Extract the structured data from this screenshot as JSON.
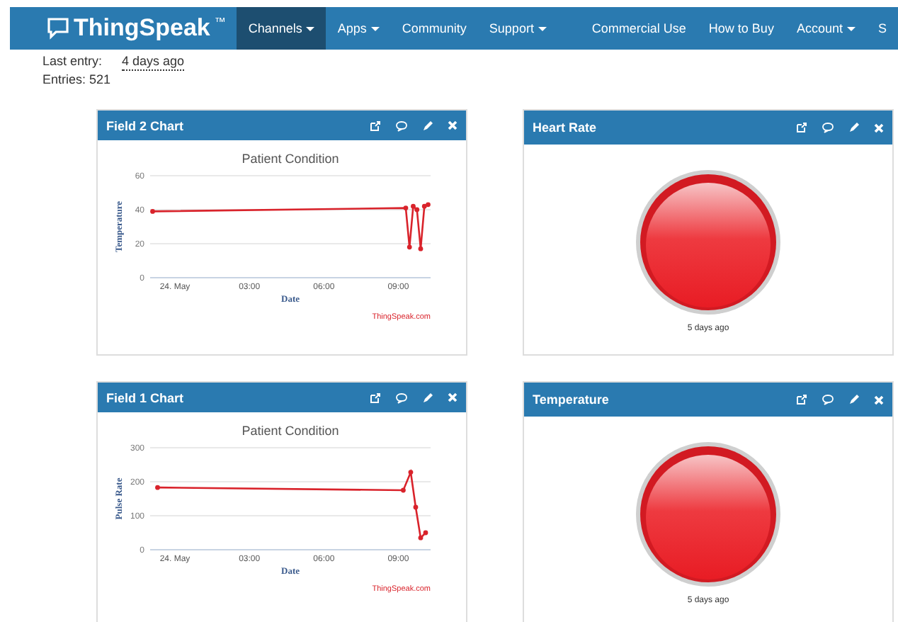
{
  "navbar": {
    "logo": "ThingSpeak",
    "trademark": "™",
    "items": [
      {
        "label": "Channels",
        "dropdown": true,
        "selected": true
      },
      {
        "label": "Apps",
        "dropdown": true,
        "selected": false
      },
      {
        "label": "Community",
        "dropdown": false,
        "selected": false
      },
      {
        "label": "Support",
        "dropdown": true,
        "selected": false
      }
    ],
    "right_items": [
      {
        "label": "Commercial Use",
        "dropdown": false,
        "selected": false
      },
      {
        "label": "How to Buy",
        "dropdown": false,
        "selected": false
      },
      {
        "label": "Account",
        "dropdown": true,
        "selected": false
      },
      {
        "label": "S",
        "dropdown": false,
        "selected": false
      }
    ]
  },
  "channel_info": {
    "last_entry_label": "Last entry:",
    "last_entry_value": "4 days ago",
    "entries": "Entries: 521"
  },
  "widgets": [
    {
      "kind": "chart",
      "title": "Field 2 Chart",
      "credit": "ThingSpeak.com",
      "chart_data": {
        "type": "line",
        "title": "Patient Condition",
        "xlabel": "Date",
        "ylabel": "Temperature",
        "x": [
          -0.9,
          9.3,
          9.45,
          9.6,
          9.75,
          9.9,
          10.05,
          10.2
        ],
        "series": [
          {
            "color": "#d9232b",
            "marker": "circle",
            "values": [
              39,
              41,
              18,
              42,
              40,
              17,
              42,
              43
            ]
          }
        ],
        "xlim": [
          -1,
          10.3
        ],
        "ylim": [
          0,
          60
        ],
        "xticks": [
          {
            "value": 0,
            "label": "24. May"
          },
          {
            "value": 3,
            "label": "03:00"
          },
          {
            "value": 6,
            "label": "06:00"
          },
          {
            "value": 9,
            "label": "09:00"
          }
        ],
        "yticks": [
          0,
          20,
          40,
          60
        ]
      }
    },
    {
      "kind": "lamp",
      "title": "Heart Rate",
      "caption": "5 days ago"
    },
    {
      "kind": "chart",
      "title": "Field 1 Chart",
      "credit": "ThingSpeak.com",
      "chart_data": {
        "type": "line",
        "title": "Patient Condition",
        "xlabel": "Date",
        "ylabel": "Pulse Rate",
        "x": [
          -0.7,
          9.2,
          9.5,
          9.7,
          9.9,
          10.1
        ],
        "series": [
          {
            "color": "#d9232b",
            "marker": "circle",
            "values": [
              183,
              175,
              228,
              125,
              35,
              50
            ]
          }
        ],
        "xlim": [
          -1,
          10.3
        ],
        "ylim": [
          0,
          300
        ],
        "xticks": [
          {
            "value": 0,
            "label": "24. May"
          },
          {
            "value": 3,
            "label": "03:00"
          },
          {
            "value": 6,
            "label": "06:00"
          },
          {
            "value": 9,
            "label": "09:00"
          }
        ],
        "yticks": [
          0,
          100,
          200,
          300
        ]
      }
    },
    {
      "kind": "lamp",
      "title": "Temperature",
      "caption": "5 days ago"
    }
  ]
}
